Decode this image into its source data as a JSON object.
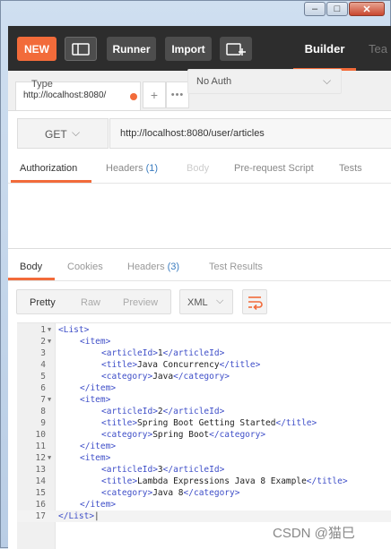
{
  "window": {
    "minimize_glyph": "–",
    "maximize_glyph": "□",
    "close_glyph": "✕"
  },
  "topbar": {
    "new_label": "NEW",
    "runner_label": "Runner",
    "import_label": "Import",
    "builder_label": "Builder",
    "team_label": "Tea"
  },
  "tabs": {
    "request_tab_label": "http://localhost:8080/",
    "plus_glyph": "+",
    "more_glyph": "•••",
    "unsaved_dot_color": "#f26b3a"
  },
  "request": {
    "method": "GET",
    "url": "http://localhost:8080/user/articles"
  },
  "request_tabs": {
    "authorization": "Authorization",
    "headers": "Headers",
    "headers_count": "(1)",
    "body": "Body",
    "prerequest": "Pre-request Script",
    "tests": "Tests"
  },
  "auth": {
    "type_label": "Type",
    "type_value": "No Auth"
  },
  "response_tabs": {
    "body": "Body",
    "cookies": "Cookies",
    "headers": "Headers",
    "headers_count": "(3)",
    "test_results": "Test Results"
  },
  "view": {
    "pretty": "Pretty",
    "raw": "Raw",
    "preview": "Preview",
    "format": "XML"
  },
  "response_body": [
    {
      "n": "1",
      "fold": true,
      "indent": 0,
      "tag": "List",
      "value": null,
      "close_only": false
    },
    {
      "n": "2",
      "fold": true,
      "indent": 1,
      "tag": "item",
      "value": null,
      "close_only": false
    },
    {
      "n": "3",
      "fold": false,
      "indent": 2,
      "tag": "articleId",
      "value": "1",
      "close_only": false
    },
    {
      "n": "4",
      "fold": false,
      "indent": 2,
      "tag": "title",
      "value": "Java Concurrency",
      "close_only": false
    },
    {
      "n": "5",
      "fold": false,
      "indent": 2,
      "tag": "category",
      "value": "Java",
      "close_only": false
    },
    {
      "n": "6",
      "fold": false,
      "indent": 1,
      "tag": "item",
      "value": null,
      "close_only": true
    },
    {
      "n": "7",
      "fold": true,
      "indent": 1,
      "tag": "item",
      "value": null,
      "close_only": false
    },
    {
      "n": "8",
      "fold": false,
      "indent": 2,
      "tag": "articleId",
      "value": "2",
      "close_only": false
    },
    {
      "n": "9",
      "fold": false,
      "indent": 2,
      "tag": "title",
      "value": "Spring Boot Getting Started",
      "close_only": false
    },
    {
      "n": "10",
      "fold": false,
      "indent": 2,
      "tag": "category",
      "value": "Spring Boot",
      "close_only": false
    },
    {
      "n": "11",
      "fold": false,
      "indent": 1,
      "tag": "item",
      "value": null,
      "close_only": true
    },
    {
      "n": "12",
      "fold": true,
      "indent": 1,
      "tag": "item",
      "value": null,
      "close_only": false
    },
    {
      "n": "13",
      "fold": false,
      "indent": 2,
      "tag": "articleId",
      "value": "3",
      "close_only": false
    },
    {
      "n": "14",
      "fold": false,
      "indent": 2,
      "tag": "title",
      "value": "Lambda Expressions Java 8 Example",
      "close_only": false
    },
    {
      "n": "15",
      "fold": false,
      "indent": 2,
      "tag": "category",
      "value": "Java 8",
      "close_only": false
    },
    {
      "n": "16",
      "fold": false,
      "indent": 1,
      "tag": "item",
      "value": null,
      "close_only": true
    },
    {
      "n": "17",
      "fold": false,
      "indent": 0,
      "tag": "List",
      "value": null,
      "close_only": true
    }
  ],
  "watermark": "CSDN @猫巳",
  "colors": {
    "accent": "#f26b3a",
    "topbar": "#2d2d2d",
    "xml_tag": "#3e4ec8",
    "count_blue": "#3b7cbf"
  }
}
